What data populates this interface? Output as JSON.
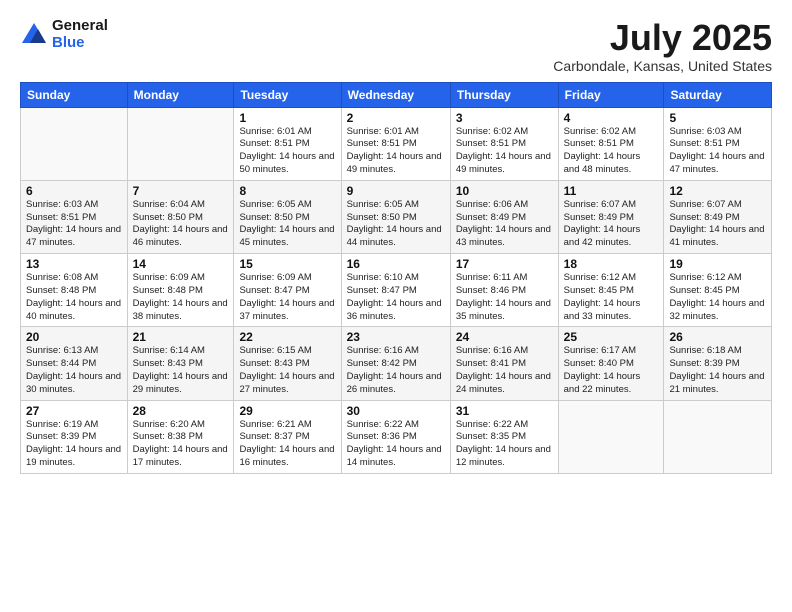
{
  "logo": {
    "general": "General",
    "blue": "Blue"
  },
  "title": "July 2025",
  "subtitle": "Carbondale, Kansas, United States",
  "headers": [
    "Sunday",
    "Monday",
    "Tuesday",
    "Wednesday",
    "Thursday",
    "Friday",
    "Saturday"
  ],
  "weeks": [
    [
      {
        "day": "",
        "info": ""
      },
      {
        "day": "",
        "info": ""
      },
      {
        "day": "1",
        "info": "Sunrise: 6:01 AM\nSunset: 8:51 PM\nDaylight: 14 hours and 50 minutes."
      },
      {
        "day": "2",
        "info": "Sunrise: 6:01 AM\nSunset: 8:51 PM\nDaylight: 14 hours and 49 minutes."
      },
      {
        "day": "3",
        "info": "Sunrise: 6:02 AM\nSunset: 8:51 PM\nDaylight: 14 hours and 49 minutes."
      },
      {
        "day": "4",
        "info": "Sunrise: 6:02 AM\nSunset: 8:51 PM\nDaylight: 14 hours and 48 minutes."
      },
      {
        "day": "5",
        "info": "Sunrise: 6:03 AM\nSunset: 8:51 PM\nDaylight: 14 hours and 47 minutes."
      }
    ],
    [
      {
        "day": "6",
        "info": "Sunrise: 6:03 AM\nSunset: 8:51 PM\nDaylight: 14 hours and 47 minutes."
      },
      {
        "day": "7",
        "info": "Sunrise: 6:04 AM\nSunset: 8:50 PM\nDaylight: 14 hours and 46 minutes."
      },
      {
        "day": "8",
        "info": "Sunrise: 6:05 AM\nSunset: 8:50 PM\nDaylight: 14 hours and 45 minutes."
      },
      {
        "day": "9",
        "info": "Sunrise: 6:05 AM\nSunset: 8:50 PM\nDaylight: 14 hours and 44 minutes."
      },
      {
        "day": "10",
        "info": "Sunrise: 6:06 AM\nSunset: 8:49 PM\nDaylight: 14 hours and 43 minutes."
      },
      {
        "day": "11",
        "info": "Sunrise: 6:07 AM\nSunset: 8:49 PM\nDaylight: 14 hours and 42 minutes."
      },
      {
        "day": "12",
        "info": "Sunrise: 6:07 AM\nSunset: 8:49 PM\nDaylight: 14 hours and 41 minutes."
      }
    ],
    [
      {
        "day": "13",
        "info": "Sunrise: 6:08 AM\nSunset: 8:48 PM\nDaylight: 14 hours and 40 minutes."
      },
      {
        "day": "14",
        "info": "Sunrise: 6:09 AM\nSunset: 8:48 PM\nDaylight: 14 hours and 38 minutes."
      },
      {
        "day": "15",
        "info": "Sunrise: 6:09 AM\nSunset: 8:47 PM\nDaylight: 14 hours and 37 minutes."
      },
      {
        "day": "16",
        "info": "Sunrise: 6:10 AM\nSunset: 8:47 PM\nDaylight: 14 hours and 36 minutes."
      },
      {
        "day": "17",
        "info": "Sunrise: 6:11 AM\nSunset: 8:46 PM\nDaylight: 14 hours and 35 minutes."
      },
      {
        "day": "18",
        "info": "Sunrise: 6:12 AM\nSunset: 8:45 PM\nDaylight: 14 hours and 33 minutes."
      },
      {
        "day": "19",
        "info": "Sunrise: 6:12 AM\nSunset: 8:45 PM\nDaylight: 14 hours and 32 minutes."
      }
    ],
    [
      {
        "day": "20",
        "info": "Sunrise: 6:13 AM\nSunset: 8:44 PM\nDaylight: 14 hours and 30 minutes."
      },
      {
        "day": "21",
        "info": "Sunrise: 6:14 AM\nSunset: 8:43 PM\nDaylight: 14 hours and 29 minutes."
      },
      {
        "day": "22",
        "info": "Sunrise: 6:15 AM\nSunset: 8:43 PM\nDaylight: 14 hours and 27 minutes."
      },
      {
        "day": "23",
        "info": "Sunrise: 6:16 AM\nSunset: 8:42 PM\nDaylight: 14 hours and 26 minutes."
      },
      {
        "day": "24",
        "info": "Sunrise: 6:16 AM\nSunset: 8:41 PM\nDaylight: 14 hours and 24 minutes."
      },
      {
        "day": "25",
        "info": "Sunrise: 6:17 AM\nSunset: 8:40 PM\nDaylight: 14 hours and 22 minutes."
      },
      {
        "day": "26",
        "info": "Sunrise: 6:18 AM\nSunset: 8:39 PM\nDaylight: 14 hours and 21 minutes."
      }
    ],
    [
      {
        "day": "27",
        "info": "Sunrise: 6:19 AM\nSunset: 8:39 PM\nDaylight: 14 hours and 19 minutes."
      },
      {
        "day": "28",
        "info": "Sunrise: 6:20 AM\nSunset: 8:38 PM\nDaylight: 14 hours and 17 minutes."
      },
      {
        "day": "29",
        "info": "Sunrise: 6:21 AM\nSunset: 8:37 PM\nDaylight: 14 hours and 16 minutes."
      },
      {
        "day": "30",
        "info": "Sunrise: 6:22 AM\nSunset: 8:36 PM\nDaylight: 14 hours and 14 minutes."
      },
      {
        "day": "31",
        "info": "Sunrise: 6:22 AM\nSunset: 8:35 PM\nDaylight: 14 hours and 12 minutes."
      },
      {
        "day": "",
        "info": ""
      },
      {
        "day": "",
        "info": ""
      }
    ]
  ]
}
